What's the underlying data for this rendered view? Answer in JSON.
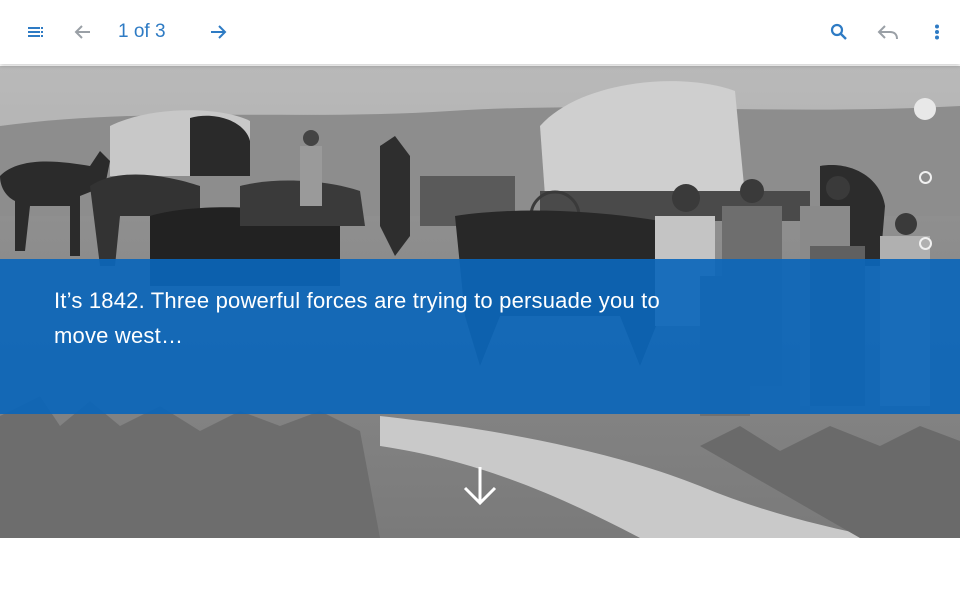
{
  "toolbar": {
    "menu_icon": "toc-menu-icon",
    "back_icon": "arrow-left-icon",
    "page_counter": "1 of 3",
    "forward_icon": "arrow-right-icon",
    "search_icon": "search-icon",
    "reply_icon": "reply-icon",
    "more_icon": "more-vertical-icon"
  },
  "hero": {
    "caption": "It’s 1842. Three powerful forces are trying to persuade you to move west…",
    "dots": [
      "active",
      "inactive",
      "inactive"
    ],
    "scroll_icon": "arrow-down-icon"
  },
  "colors": {
    "accent": "#2e7bc4",
    "banner": "#0b66ba"
  }
}
